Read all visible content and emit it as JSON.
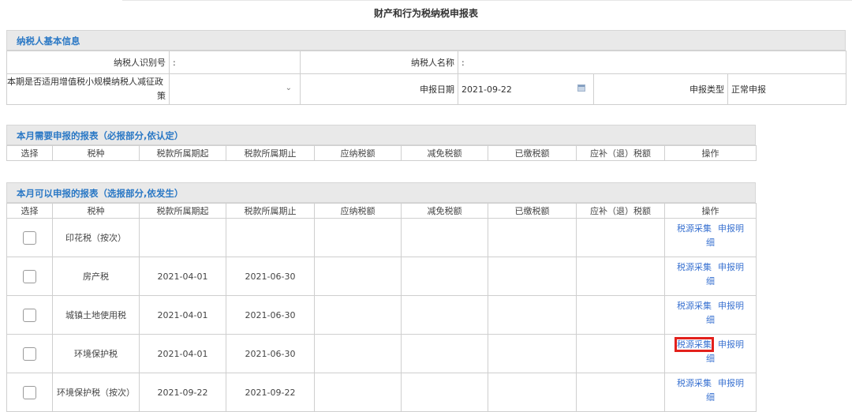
{
  "page": {
    "title": "财产和行为税纳税申报表"
  },
  "basic_info": {
    "header": "纳税人基本信息",
    "taxpayer_id_label": "纳税人识别号",
    "taxpayer_id_value": ":",
    "taxpayer_name_label": "纳税人名称",
    "taxpayer_name_value": ":",
    "policy_label_line1": "本期是否适用增值税小规模纳税人减征政",
    "policy_label_line2": "策",
    "policy_value": "",
    "date_label": "申报日期",
    "date_value": "2021-09-22",
    "type_label": "申报类型",
    "type_value": "正常申报"
  },
  "columns": [
    "选择",
    "税种",
    "税款所属期起",
    "税款所属期止",
    "应纳税额",
    "减免税额",
    "已缴税额",
    "应补（退）税额",
    "操作"
  ],
  "required_section": {
    "header": "本月需要申报的报表（必报部分,依认定）"
  },
  "optional_section": {
    "header": "本月可以申报的报表（选报部分,依发生）",
    "rows": [
      {
        "tax": "印花税（按次）",
        "start": "",
        "end": "",
        "op1": "税源采集",
        "op2a": "申报明",
        "op2b": "细"
      },
      {
        "tax": "房产税",
        "start": "2021-04-01",
        "end": "2021-06-30",
        "op1": "税源采集",
        "op2a": "申报明",
        "op2b": "细"
      },
      {
        "tax": "城镇土地使用税",
        "start": "2021-04-01",
        "end": "2021-06-30",
        "op1": "税源采集",
        "op2a": "申报明",
        "op2b": "细"
      },
      {
        "tax": "环境保护税",
        "start": "2021-04-01",
        "end": "2021-06-30",
        "op1": "税源采集",
        "op2a": "申报明",
        "op2b": "细"
      },
      {
        "tax": "环境保护税（按次）",
        "start": "2021-09-22",
        "end": "2021-09-22",
        "op1": "税源采集",
        "op2a": "申报明",
        "op2b": "细"
      }
    ]
  },
  "colors": {
    "accent": "#2a78c5",
    "link": "#3b73d1",
    "highlight": "#e3211c"
  },
  "icons": {
    "dropdown": "chevron-down-icon",
    "calendar": "calendar-icon"
  }
}
